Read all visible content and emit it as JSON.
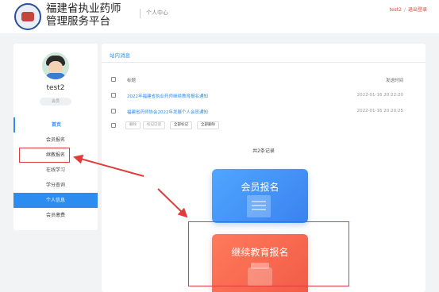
{
  "header": {
    "title_line1": "福建省执业药师",
    "title_line2": "管理服务平台",
    "section": "个人中心",
    "username": "test2",
    "separator": "/",
    "logout": "退出登录"
  },
  "sidebar": {
    "username": "test2",
    "badge": "会员",
    "items": [
      {
        "label": "首页",
        "state": "active"
      },
      {
        "label": "会员报名",
        "state": ""
      },
      {
        "label": "继教报名",
        "state": "highlighted"
      },
      {
        "label": "在线学习",
        "state": ""
      },
      {
        "label": "学分查询",
        "state": ""
      },
      {
        "label": "个人信息",
        "state": "selected"
      },
      {
        "label": "会员缴费",
        "state": ""
      }
    ]
  },
  "messages": {
    "title": "站内消息",
    "col_title": "标题",
    "col_time": "发送时间",
    "rows": [
      {
        "title": "2022年福建省执业药师继续教育报名通知",
        "time": "2022-01-16 20:22:20"
      },
      {
        "title": "福建省药师协会2022年发展个人会员通知",
        "time": "2022-01-16 20:20:25"
      }
    ],
    "actions": {
      "delete": "删除",
      "mark_read": "标记已读",
      "mark_all": "全部标记",
      "delete_all": "全部删除"
    },
    "total": "共2条记录"
  },
  "cards": {
    "member": "会员报名",
    "education": "继续教育报名"
  },
  "colors": {
    "accent": "#2d8cf0",
    "highlight": "#e23b3b",
    "card_blue": "#3b82f0",
    "card_red": "#f25c47"
  }
}
